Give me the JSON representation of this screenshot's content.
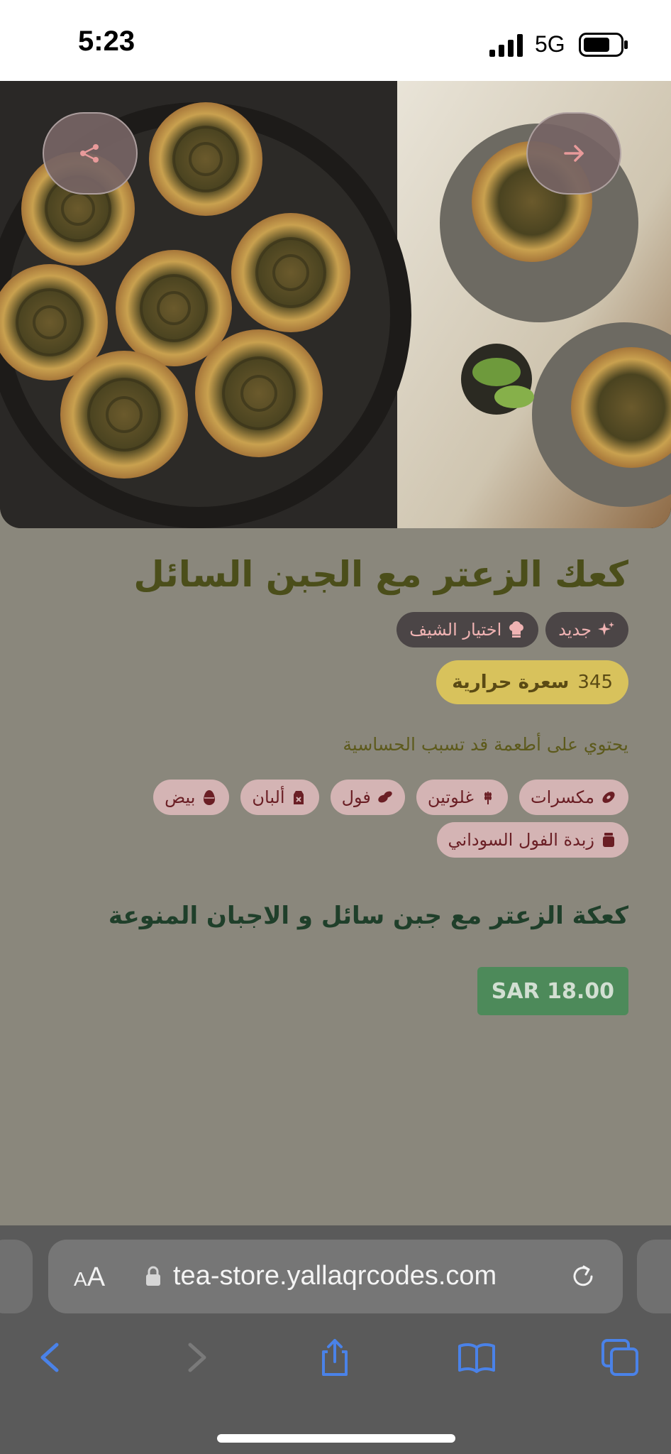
{
  "status_bar": {
    "time": "5:23",
    "network": "5G",
    "icons": [
      "signal-icon",
      "battery-icon"
    ]
  },
  "hero": {
    "image": "zaatar-cheese-rolls-photo",
    "buttons": [
      {
        "name": "share-icon"
      },
      {
        "name": "arrow-right-icon"
      }
    ]
  },
  "product": {
    "title": "كعك الزعتر مع الجبن السائل",
    "badges": [
      {
        "label": "جديد",
        "icon": "sparkles-icon"
      },
      {
        "label": "اختيار الشيف",
        "icon": "chef-hat-icon"
      }
    ],
    "calories": {
      "value": "345",
      "label": "سعرة حرارية"
    },
    "allergy_note": "يحتوي على أطعمة قد تسبب الحساسية",
    "allergens": [
      {
        "label": "مكسرات",
        "icon": "nut-icon"
      },
      {
        "label": "غلوتين",
        "icon": "wheat-icon"
      },
      {
        "label": "فول",
        "icon": "bean-icon"
      },
      {
        "label": "ألبان",
        "icon": "milk-icon"
      },
      {
        "label": "بيض",
        "icon": "egg-icon"
      },
      {
        "label": "زبدة الفول السوداني",
        "icon": "peanut-butter-jar-icon"
      }
    ],
    "description": "كعكة الزعتر مع جبن سائل و الاجبان المنوعة",
    "price": "SAR 18.00"
  },
  "browser": {
    "text_size_label_small": "A",
    "text_size_label_large": "A",
    "url": "tea-store.yallaqrcodes.com",
    "toolbar": [
      "back-icon",
      "forward-icon",
      "share-icon",
      "bookmarks-icon",
      "tabs-icon"
    ]
  },
  "colors": {
    "background": "#8a877c",
    "title": "#4b4e1a",
    "badge_bg": "#4b4546",
    "badge_text": "#f0b3b3",
    "calories_bg": "#d8c25c",
    "allergen_bg": "#d4b4b4",
    "allergen_text": "#6a1e24",
    "price_bg": "#4d8a5a",
    "description": "#1f3f2a",
    "browser_bar": "#5a5a5a",
    "toolbar_icons": "#4a82e8"
  }
}
